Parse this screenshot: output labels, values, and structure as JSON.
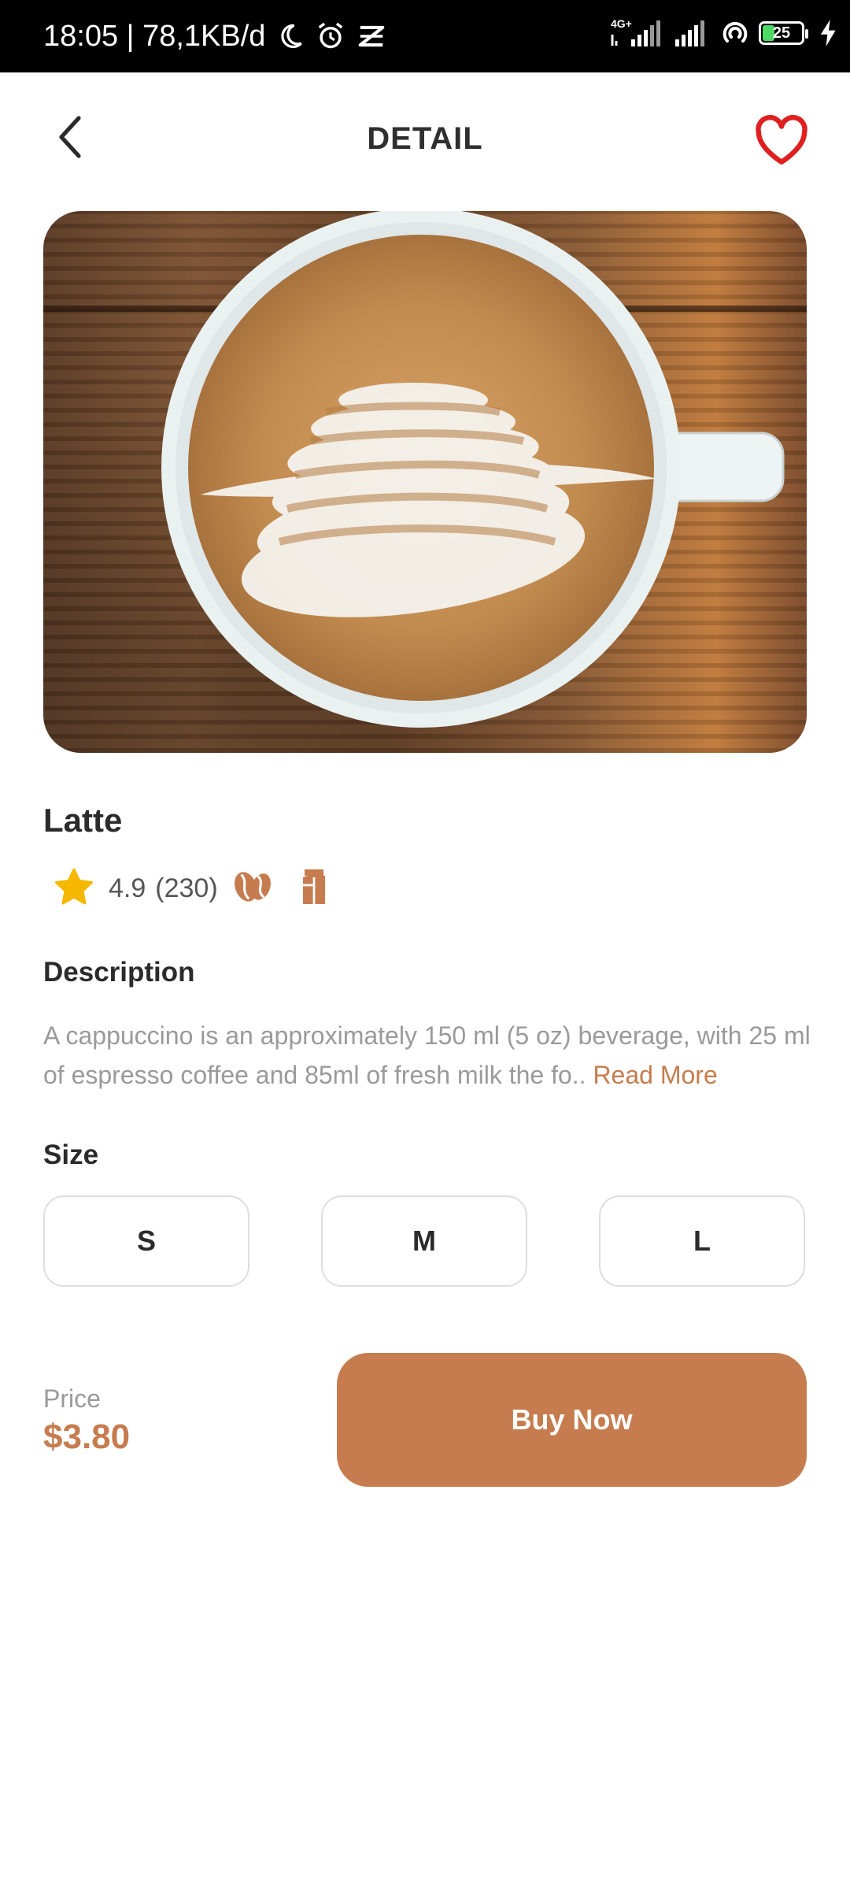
{
  "status_bar": {
    "time_info": "18:05 | 78,1KB/d",
    "network": "4G+",
    "battery": "25",
    "icons": [
      "moon-icon",
      "alarm-icon",
      "nfc-icon",
      "signal-icon",
      "signal-icon",
      "hotspot-icon",
      "battery-icon",
      "charging-icon"
    ]
  },
  "header": {
    "title": "DETAIL",
    "back_icon": "chevron-left-icon",
    "favorite_icon": "heart-outline-icon"
  },
  "product": {
    "name": "Latte",
    "rating": "4.9",
    "rating_count": "(230)",
    "feature_icons": [
      "coffee-bean-icon",
      "milk-carton-icon"
    ]
  },
  "description": {
    "title": "Description",
    "text": "A cappuccino is an approximately 150 ml (5 oz) beverage, with 25 ml of espresso coffee and 85ml of fresh milk the fo..",
    "read_more": "Read More"
  },
  "size": {
    "title": "Size",
    "options": [
      "S",
      "M",
      "L"
    ]
  },
  "checkout": {
    "price_label": "Price",
    "price": "$3.80",
    "buy_label": "Buy Now"
  },
  "colors": {
    "accent": "#c67c4e",
    "favorite": "#e02020",
    "star": "#f6b700",
    "status_bar": "#000000"
  }
}
